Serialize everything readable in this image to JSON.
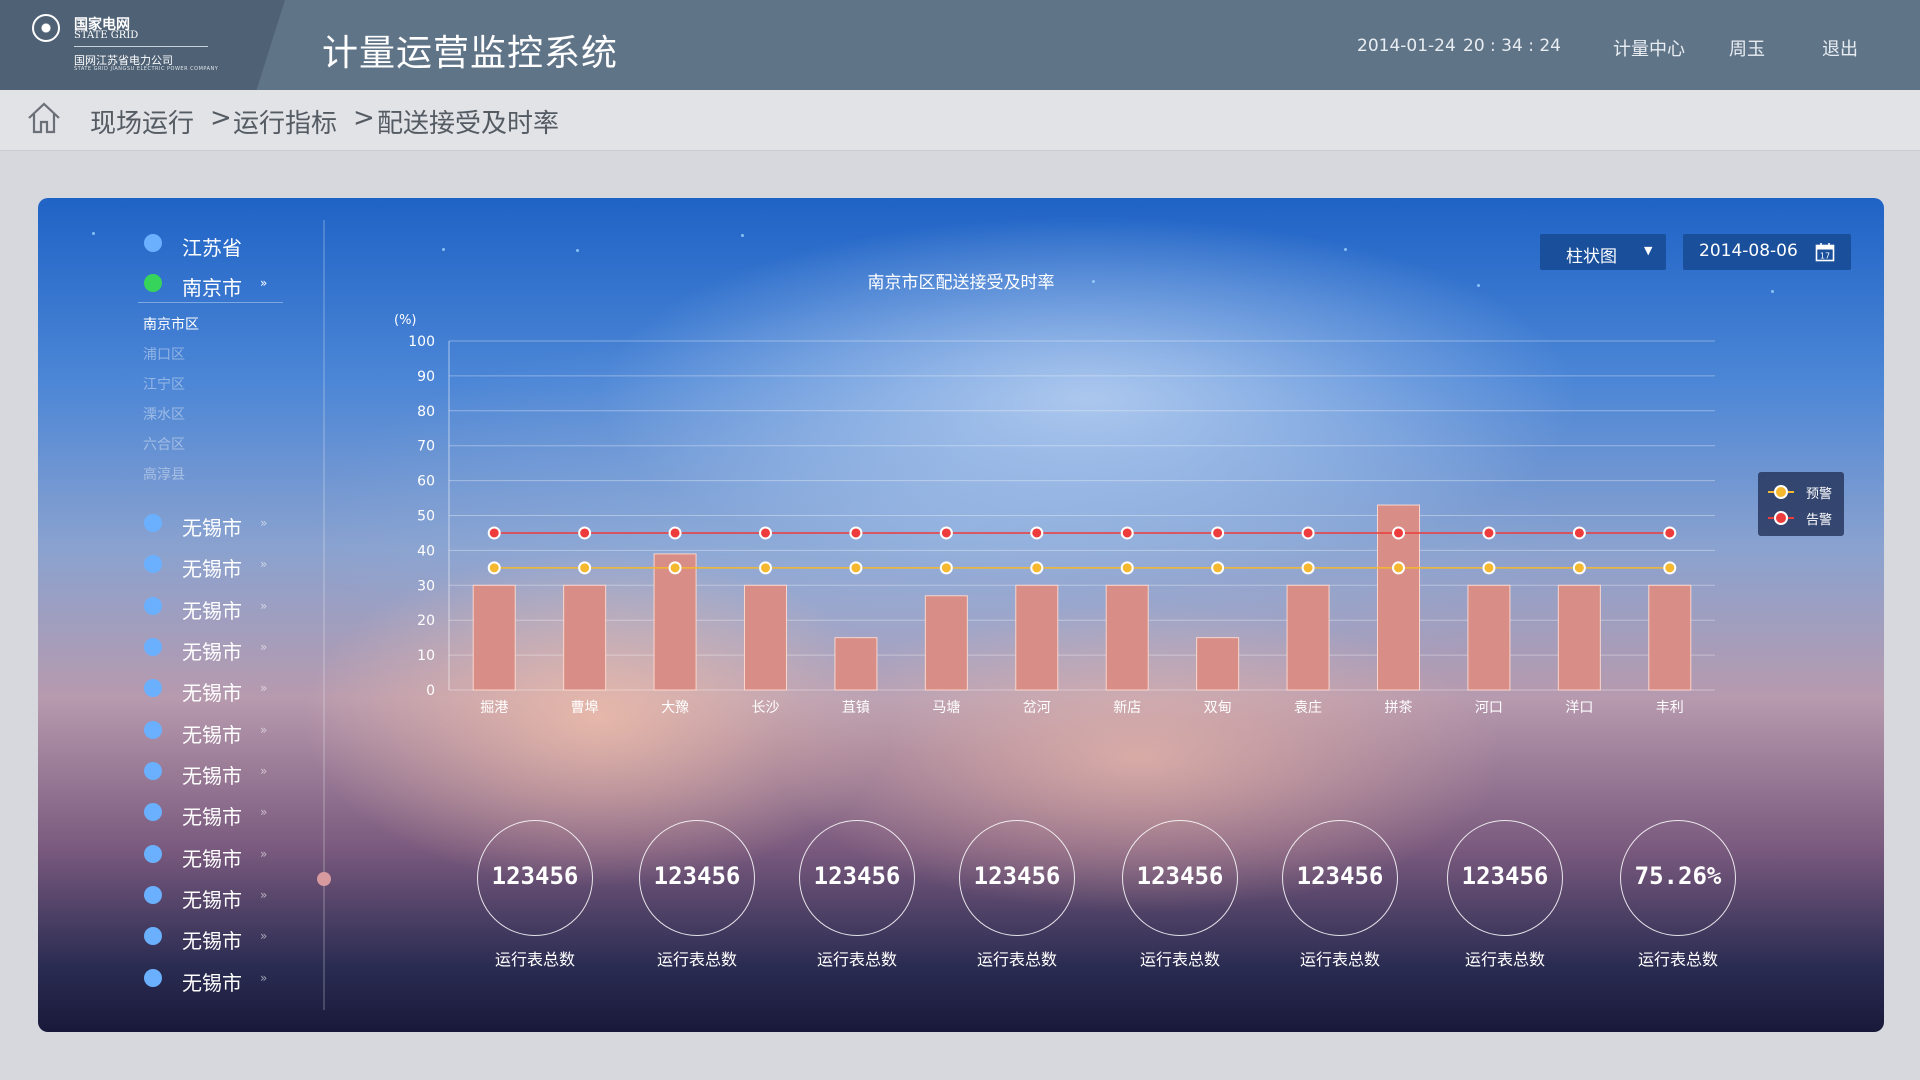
{
  "header": {
    "logo_cn": "国家电网",
    "logo_en": "STATE GRID",
    "logo_company": "国网江苏省电力公司",
    "logo_company_en": "STATE GRID JIANGSU ELECTRIC POWER COMPANY",
    "app_title": "计量运营监控系统",
    "date": "2014-01-24",
    "time": "20 : 34 : 24",
    "nav": [
      "计量中心",
      "周玉",
      "退出"
    ]
  },
  "breadcrumb": [
    "现场运行",
    ">",
    "运行指标",
    ">",
    "配送接受及时率"
  ],
  "sidebar": {
    "province": "江苏省",
    "city": "南京市",
    "districts": [
      "南京市区",
      "浦口区",
      "江宁区",
      "溧水区",
      "六合区",
      "高淳县"
    ],
    "other_cities": [
      "无锡市",
      "无锡市",
      "无锡市",
      "无锡市",
      "无锡市",
      "无锡市",
      "无锡市",
      "无锡市",
      "无锡市",
      "无锡市",
      "无锡市",
      "无锡市"
    ]
  },
  "controls": {
    "chart_type": "柱状图",
    "date": "2014-08-06",
    "calendar_day": "17"
  },
  "chart_data": {
    "type": "bar",
    "title": "南京市区配送接受及时率",
    "ylabel": "(%)",
    "ylim": [
      0,
      100
    ],
    "yticks": [
      0,
      10,
      20,
      30,
      40,
      50,
      60,
      70,
      80,
      90,
      100
    ],
    "categories": [
      "掘港",
      "曹埠",
      "大豫",
      "长沙",
      "苴镇",
      "马塘",
      "岔河",
      "新店",
      "双甸",
      "袁庄",
      "拼茶",
      "河口",
      "洋口",
      "丰利"
    ],
    "values": [
      30,
      30,
      39,
      30,
      15,
      27,
      30,
      30,
      15,
      30,
      53,
      30,
      30,
      30
    ],
    "lines": [
      {
        "name": "预警",
        "color": "#f5b82e",
        "value": 35
      },
      {
        "name": "告警",
        "color": "#ee3b3b",
        "value": 45
      }
    ],
    "bar_color": "#d88e86",
    "grid": true,
    "legend": "right"
  },
  "stats": [
    {
      "value": "123456",
      "label": "运行表总数"
    },
    {
      "value": "123456",
      "label": "运行表总数"
    },
    {
      "value": "123456",
      "label": "运行表总数"
    },
    {
      "value": "123456",
      "label": "运行表总数"
    },
    {
      "value": "123456",
      "label": "运行表总数"
    },
    {
      "value": "123456",
      "label": "运行表总数"
    },
    {
      "value": "123456",
      "label": "运行表总数"
    },
    {
      "value": "75.26%",
      "label": "运行表总数"
    }
  ]
}
